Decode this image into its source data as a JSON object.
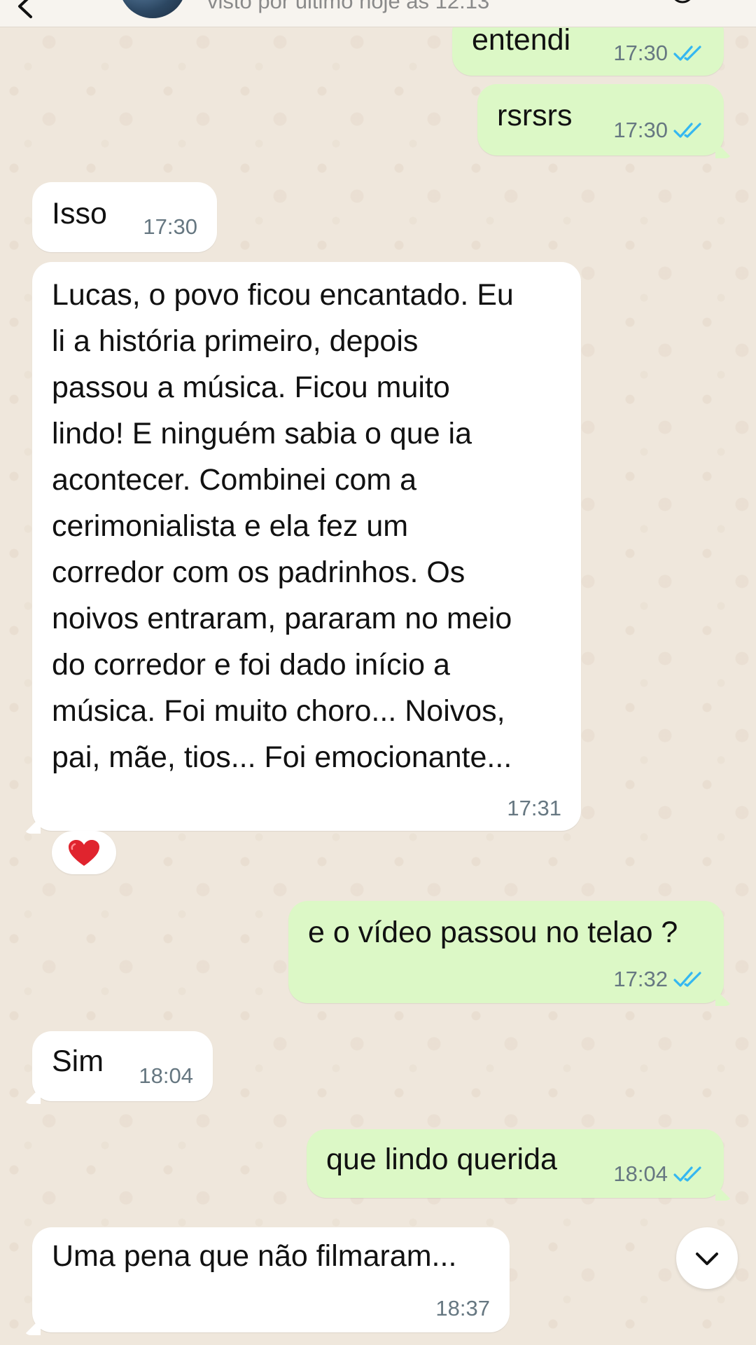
{
  "header": {
    "last_seen": "visto por último hoje às 12:13"
  },
  "messages": [
    {
      "direction": "out",
      "text": "entendi",
      "time": "17:30",
      "read": true
    },
    {
      "direction": "out",
      "text": "rsrsrs",
      "time": "17:30",
      "read": true
    },
    {
      "direction": "in",
      "text": "Isso",
      "time": "17:30"
    },
    {
      "direction": "in",
      "text": "Lucas, o povo ficou encantado. Eu\nli a história primeiro, depois\npassou a música. Ficou muito\nlindo! E ninguém sabia o que ia\nacontecer. Combinei com a\ncerimonialista e ela fez um\ncorredor com os padrinhos. Os\nnoivos entraram, pararam no meio\ndo corredor e foi dado início a\nmúsica. Foi muito choro... Noivos,\npai, mãe, tios... Foi emocionante...",
      "time": "17:31",
      "reaction": "heart-icon"
    },
    {
      "direction": "out",
      "text": "e o vídeo passou no telao ?",
      "time": "17:32",
      "read": true
    },
    {
      "direction": "in",
      "text": "Sim",
      "time": "18:04"
    },
    {
      "direction": "out",
      "text": "que lindo querida",
      "time": "18:04",
      "read": true
    },
    {
      "direction": "in",
      "text": "Uma pena que não filmaram...",
      "time": "18:37"
    }
  ],
  "colors": {
    "wallpaper": "#efe7dc",
    "incoming_bubble": "#ffffff",
    "outgoing_bubble": "#dcf8c6",
    "read_ticks": "#34b7f1",
    "timestamp": "#667781"
  }
}
